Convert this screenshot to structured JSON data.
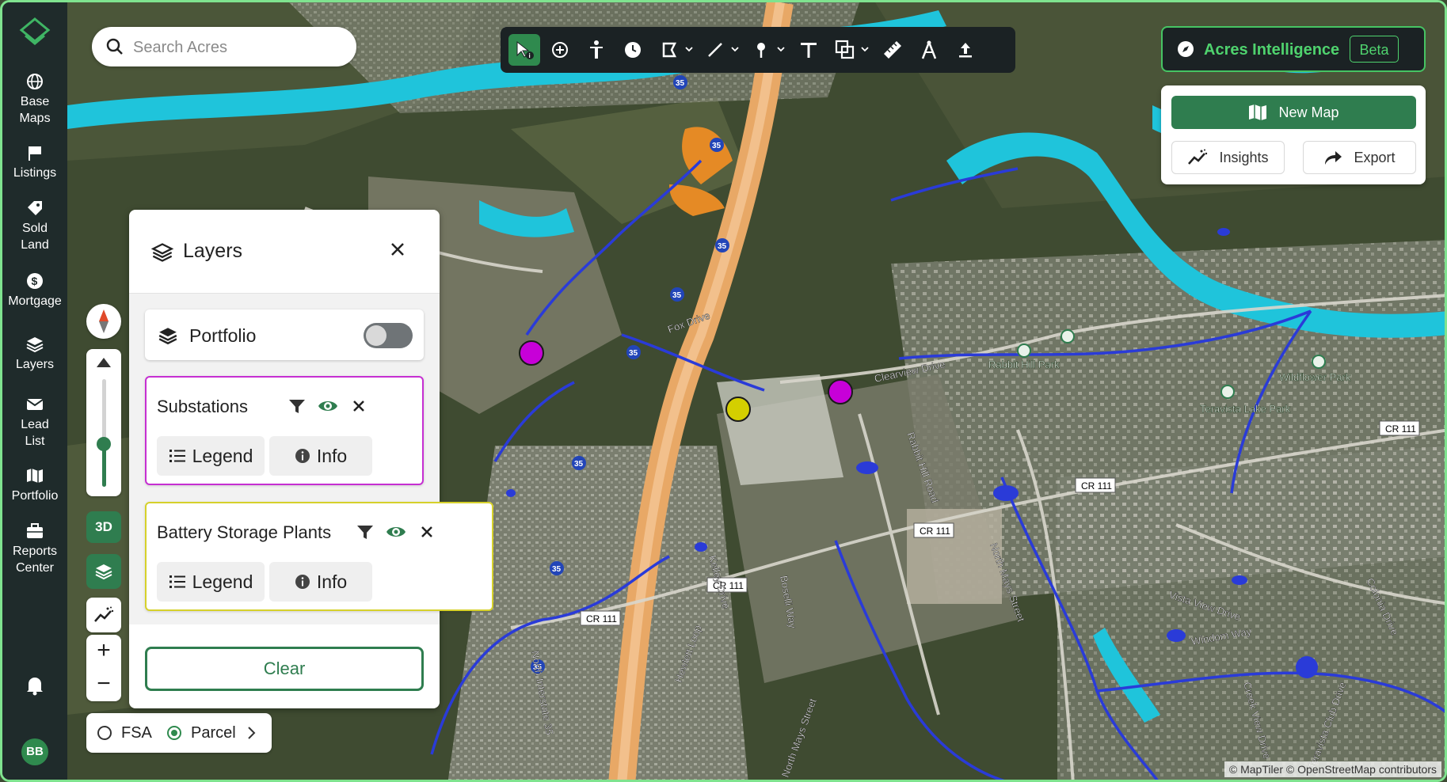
{
  "colors": {
    "accent": "#2f7d4f",
    "sidebar": "#1f2b2b",
    "ai_green": "#4fd36e",
    "substation": "#c62fd2",
    "battery": "#d6d12b"
  },
  "sidebar": {
    "items": [
      {
        "icon": "globe-icon",
        "label1": "Base",
        "label2": "Maps"
      },
      {
        "icon": "listings-icon",
        "label1": "Listings",
        "label2": ""
      },
      {
        "icon": "tag-icon",
        "label1": "Sold",
        "label2": "Land"
      },
      {
        "icon": "dollar-icon",
        "label1": "Mortgage",
        "label2": ""
      },
      {
        "icon": "layers-icon",
        "label1": "Layers",
        "label2": ""
      },
      {
        "icon": "mail-icon",
        "label1": "Lead",
        "label2": "List"
      },
      {
        "icon": "map-icon",
        "label1": "Portfolio",
        "label2": ""
      },
      {
        "icon": "briefcase-icon",
        "label1": "Reports",
        "label2": "Center"
      }
    ],
    "avatar": "BB"
  },
  "search": {
    "placeholder": "Search Acres"
  },
  "toolbar": {
    "tools": [
      "select-info-icon",
      "crosshair-icon",
      "person-icon",
      "clock-icon",
      "polygon-icon",
      "line-icon",
      "pin-icon",
      "text-icon",
      "shapes-icon",
      "ruler-icon",
      "compass-tool-icon",
      "upload-icon"
    ]
  },
  "ai": {
    "label": "Acres Intelligence",
    "badge": "Beta"
  },
  "map_actions": {
    "new_map": "New Map",
    "insights": "Insights",
    "export": "Export"
  },
  "layers": {
    "title": "Layers",
    "portfolio": {
      "label": "Portfolio",
      "enabled": false
    },
    "cards": [
      {
        "title": "Substations",
        "legend": "Legend",
        "info": "Info"
      },
      {
        "title": "Battery Storage Plants",
        "legend": "Legend",
        "info": "Info"
      }
    ],
    "clear": "Clear"
  },
  "controls": {
    "btn3d": "3D",
    "zoom_in": "+",
    "zoom_out": "−",
    "pitch": 0.6
  },
  "mode": {
    "fsa": "FSA",
    "parcel": "Parcel",
    "selected": "Parcel"
  },
  "map_labels": {
    "roads": [
      "CR 111",
      "CR 111",
      "CR 111",
      "CR 111",
      "CR 111",
      "35",
      "35",
      "35",
      "35",
      "35",
      "35",
      "35",
      "35",
      "North Interstate 35",
      "Kelley Drive",
      "Hewlett Loop",
      "Boselli Way",
      "North Mays Street",
      "Rabbit Hill Road",
      "Vista View Drive",
      "Windom Way",
      "Teravista Club Drive",
      "Clearview Drive",
      "Fox Drive",
      "Colonia Drive",
      "North Mays Street",
      "Creek View Drive"
    ],
    "parks": [
      "Rabbit Hill Park",
      "Teravista Lake Park",
      "Wildflower Park"
    ]
  },
  "attribution": "© MapTiler © OpenStreetMap contributors"
}
